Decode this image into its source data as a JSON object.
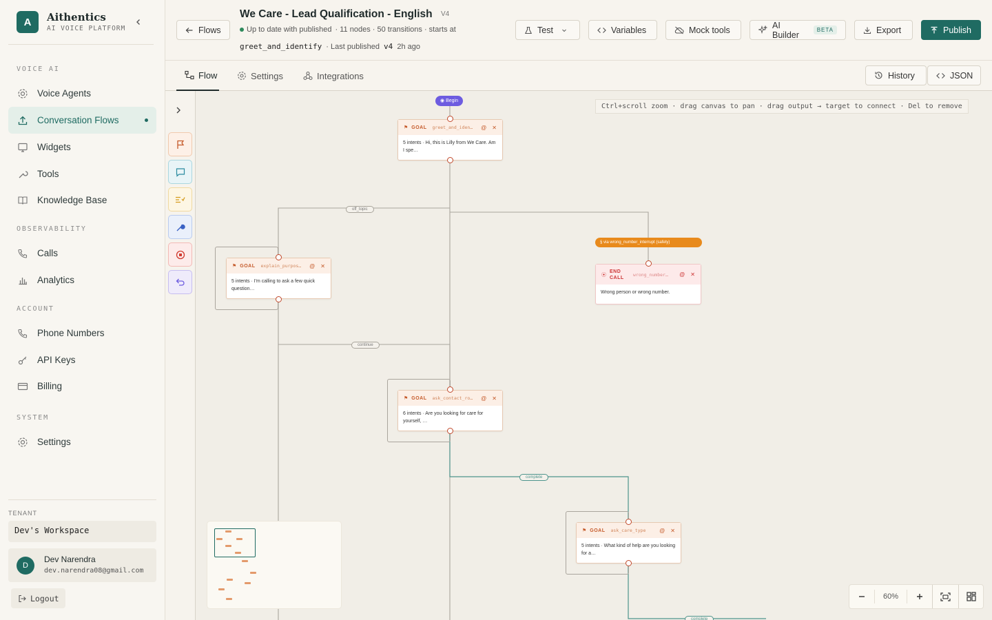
{
  "brand": {
    "name": "Aithentics",
    "subtitle": "AI VOICE PLATFORM",
    "logo_letter": "A"
  },
  "nav": {
    "sections": [
      "VOICE AI",
      "OBSERVABILITY",
      "ACCOUNT",
      "SYSTEM"
    ],
    "items": [
      {
        "label": "Voice Agents",
        "icon": "gear-icon"
      },
      {
        "label": "Conversation Flows",
        "icon": "upload-icon",
        "active": true
      },
      {
        "label": "Widgets",
        "icon": "monitor-icon"
      },
      {
        "label": "Tools",
        "icon": "wrench-icon"
      },
      {
        "label": "Knowledge Base",
        "icon": "book-icon"
      },
      {
        "label": "Calls",
        "icon": "phone-icon"
      },
      {
        "label": "Analytics",
        "icon": "bar-chart-icon"
      },
      {
        "label": "Phone Numbers",
        "icon": "phone-icon"
      },
      {
        "label": "API Keys",
        "icon": "key-icon"
      },
      {
        "label": "Billing",
        "icon": "card-icon"
      },
      {
        "label": "Settings",
        "icon": "gear-icon"
      }
    ]
  },
  "tenant": {
    "label": "TENANT",
    "name": "Dev's Workspace"
  },
  "user": {
    "initial": "D",
    "name": "Dev Narendra",
    "email": "dev.narendra08@gmail.com"
  },
  "logout_label": "Logout",
  "header": {
    "back_label": "Flows",
    "title": "We Care - Lead Qualification - English",
    "version": "V4",
    "status": "Up to date with published",
    "meta": "· 11 nodes · 50 transitions · starts at",
    "start_node": "greet_and_identify",
    "published": "· Last published",
    "published_version": "v4",
    "published_ago": "2h ago",
    "buttons": {
      "test": "Test",
      "variables": "Variables",
      "mock": "Mock tools",
      "ai_builder": "AI Builder",
      "beta": "BETA",
      "export": "Export",
      "publish": "Publish"
    }
  },
  "tabs": {
    "flow": "Flow",
    "settings": "Settings",
    "integrations": "Integrations",
    "history": "History",
    "json": "JSON"
  },
  "canvas": {
    "hint": "Ctrl+scroll zoom · drag canvas to pan · drag output → target to connect · Del to remove",
    "begin_label": "Begin",
    "interrupt_label": "via wrong_number_interrupt (safety)",
    "edge_labels": {
      "off_topic": "off_topic",
      "continue": "continue",
      "complete1": "complete",
      "complete2": "complete"
    },
    "nodes": [
      {
        "type": "GOAL",
        "id": "greet_and_iden…",
        "body": "5 intents · Hi, this is Lilly from We Care. Am I spe…"
      },
      {
        "type": "GOAL",
        "id": "explain_purpos…",
        "body": "5 intents · I'm calling to ask a few quick question…"
      },
      {
        "type": "END CALL",
        "id": "wrong_number…",
        "body": "Wrong person or wrong number."
      },
      {
        "type": "GOAL",
        "id": "ask_contact_ro…",
        "body": "6 intents · Are you looking for care for yourself, …"
      },
      {
        "type": "GOAL",
        "id": "ask_care_type",
        "body": "5 intents · What kind of help are you looking for a…"
      }
    ],
    "zoom": "60%"
  }
}
